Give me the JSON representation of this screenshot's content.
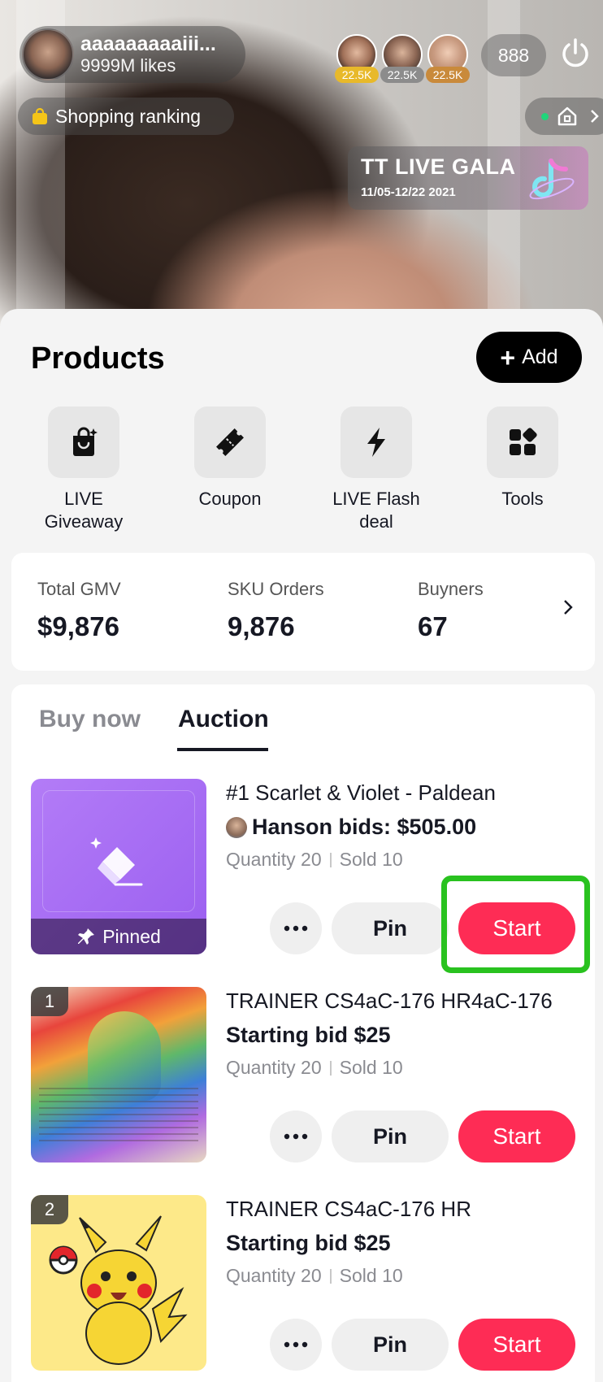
{
  "host": {
    "name": "aaaaaaaaaiii...",
    "likes": "9999M likes"
  },
  "viewers": [
    {
      "count": "22.5K",
      "color": "#e8b92a"
    },
    {
      "count": "22.5K",
      "color": "#8c8c8c"
    },
    {
      "count": "22.5K",
      "color": "#c98a3b"
    }
  ],
  "viewer_total": "888",
  "shopping_ranking": "Shopping ranking",
  "gala": {
    "title": "TT LIVE GALA",
    "dates": "11/05-12/22 2021"
  },
  "products_title": "Products",
  "add_label": "Add",
  "tools": [
    {
      "label": "LIVE Giveaway",
      "icon": "giveaway-bag-icon"
    },
    {
      "label": "Coupon",
      "icon": "coupon-ticket-icon"
    },
    {
      "label": "LIVE Flash deal",
      "icon": "lightning-icon"
    },
    {
      "label": "Tools",
      "icon": "grid-tools-icon"
    }
  ],
  "stats": [
    {
      "label": "Total GMV",
      "value": "$9,876"
    },
    {
      "label": "SKU Orders",
      "value": "9,876"
    },
    {
      "label": "Buyners",
      "value": "67"
    }
  ],
  "tabs": {
    "buy_now": "Buy now",
    "auction": "Auction"
  },
  "products": [
    {
      "title": "#1 Scarlet & Violet - Paldean",
      "bid": "Hanson bids: $505.00",
      "quantity": "Quantity 20",
      "sold": "Sold 10",
      "pin": "Pin",
      "start": "Start",
      "badge": "Pinned"
    },
    {
      "title": "TRAINER CS4aC-176 HR4aC-176",
      "bid": "Starting bid $25",
      "quantity": "Quantity 20",
      "sold": "Sold 10",
      "pin": "Pin",
      "start": "Start",
      "rank": "1"
    },
    {
      "title": "TRAINER CS4aC-176 HR",
      "bid": "Starting bid $25",
      "quantity": "Quantity 20",
      "sold": "Sold 10",
      "pin": "Pin",
      "start": "Start",
      "rank": "2"
    }
  ],
  "colors": {
    "accent": "#fe2c55",
    "highlight": "#29c21f",
    "pinned_purple": "#a66ef5"
  }
}
